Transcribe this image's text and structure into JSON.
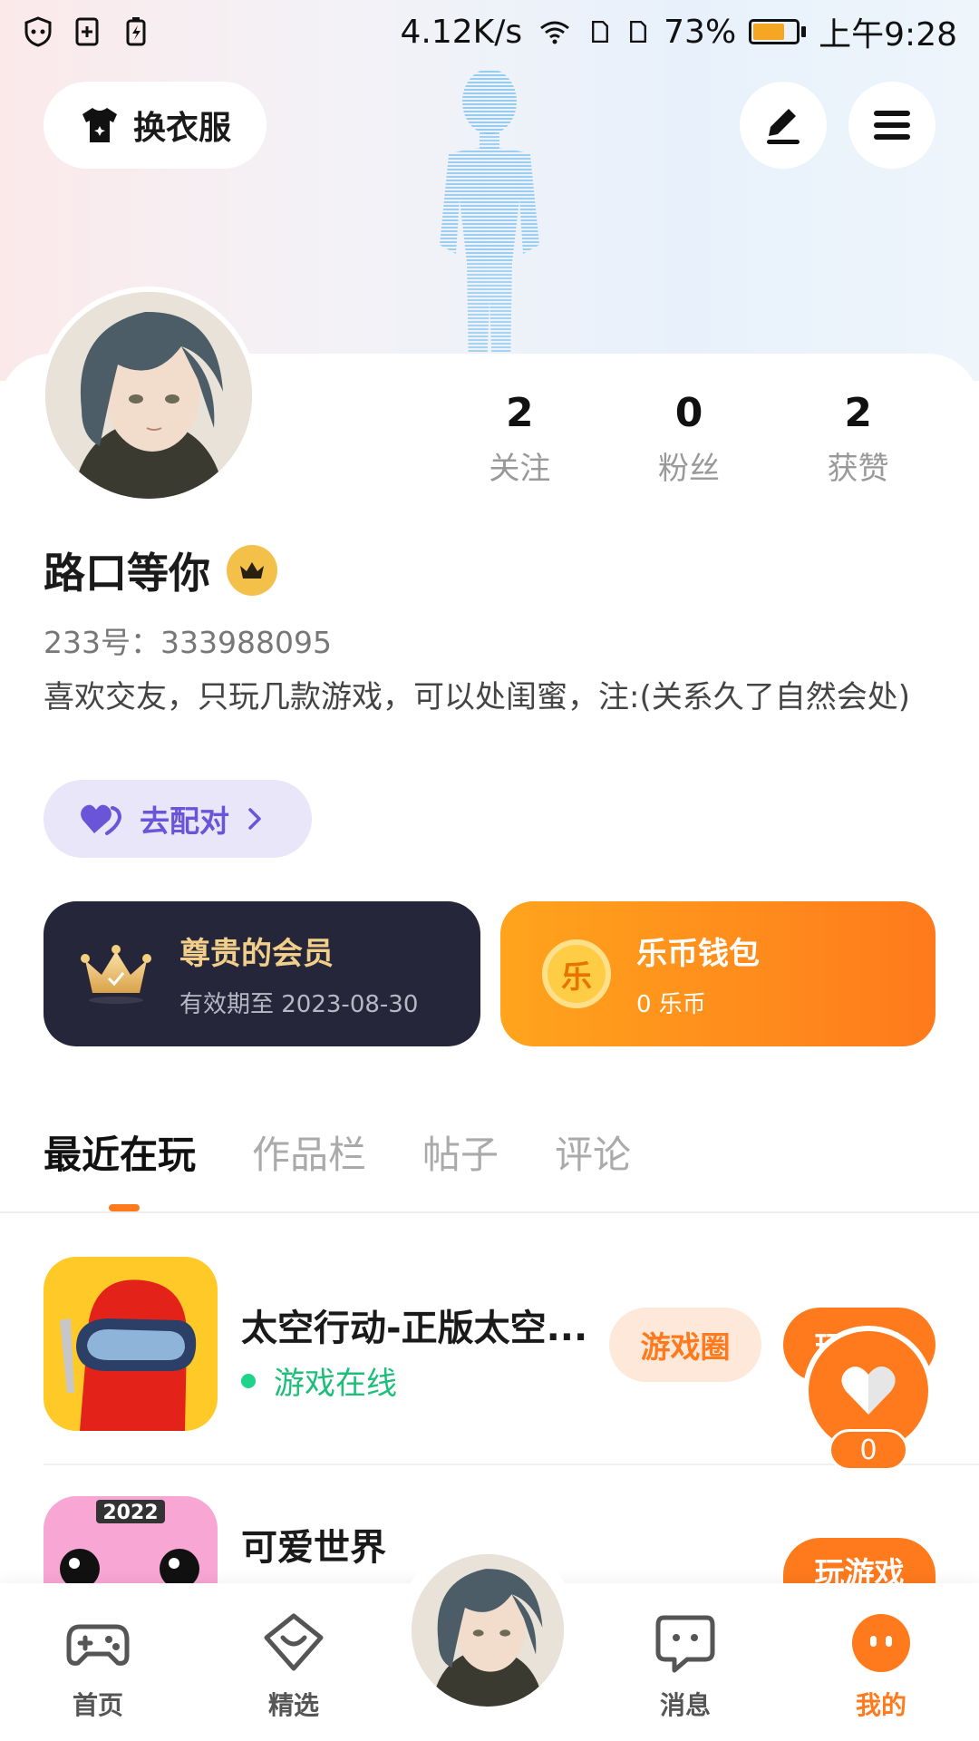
{
  "status_bar": {
    "speed": "4.12K/s",
    "battery": "73%",
    "battery_level": 0.73,
    "time": "上午9:28"
  },
  "top_actions": {
    "dress_label": "换衣服"
  },
  "stats": [
    {
      "value": "2",
      "label": "关注"
    },
    {
      "value": "0",
      "label": "粉丝"
    },
    {
      "value": "2",
      "label": "获赞"
    }
  ],
  "profile": {
    "username": "路口等你",
    "uid": "233号：333988095",
    "bio": "喜欢交友，只玩几款游戏，可以处闺蜜，注:(关系久了自然会处)"
  },
  "match_button": {
    "label": "去配对"
  },
  "vip_card": {
    "title": "尊贵的会员",
    "subtitle": "有效期至 2023-08-30"
  },
  "wallet_card": {
    "coin_glyph": "乐",
    "title": "乐币钱包",
    "subtitle": "0 乐币"
  },
  "tabs": [
    {
      "label": "最近在玩"
    },
    {
      "label": "作品栏"
    },
    {
      "label": "帖子"
    },
    {
      "label": "评论"
    }
  ],
  "games": [
    {
      "name": "太空行动-正版太空...",
      "status": "游戏在线",
      "circle_label": "游戏圈",
      "play_label": "玩游戏"
    },
    {
      "name": "可爱世界",
      "icon_text": "2022",
      "play_label": "玩游戏"
    }
  ],
  "like_float": {
    "count": "0"
  },
  "navbar": [
    {
      "label": "首页",
      "icon": "gamepad-icon"
    },
    {
      "label": "精选",
      "icon": "heart-chat-icon"
    },
    {
      "label": "消息",
      "icon": "message-icon"
    },
    {
      "label": "我的",
      "icon": "face-icon"
    }
  ],
  "colors": {
    "accent": "#ff7a1c",
    "vip_bg": "#25263a",
    "match_bg": "#e8e6f8",
    "online": "#1dbe79"
  }
}
